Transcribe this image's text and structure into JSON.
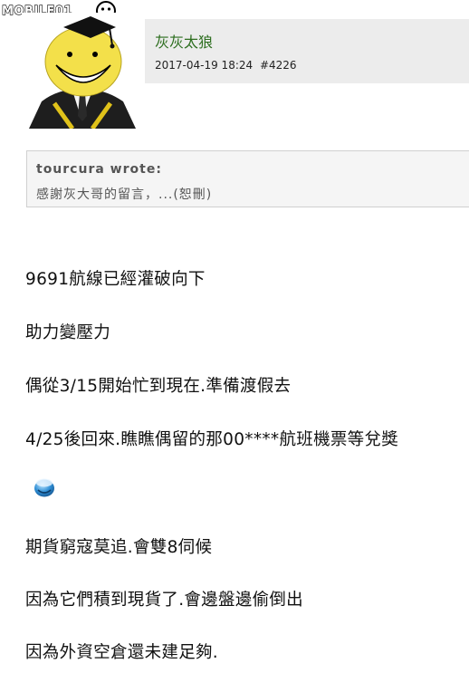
{
  "site": {
    "logo_text": "MOBILE01"
  },
  "post": {
    "username": "灰灰太狼",
    "datetime": "2017-04-19 18:24",
    "post_number": "#4226"
  },
  "quote": {
    "author": "tourcura wrote:",
    "text": "感謝灰大哥的留言，...(恕刪)"
  },
  "body_lines": [
    "9691航線已經灌破向下",
    "助力變壓力",
    "偶從3/15開始忙到現在.準備渡假去",
    "4/25後回來.瞧瞧偶留的那00****航班機票等兌獎",
    "期貨窮寇莫追.會雙8伺候",
    "因為它們積到現貨了.會邊盤邊偷倒出",
    "因為外資空倉還未建足夠."
  ],
  "emoticon": "smiley-icon"
}
